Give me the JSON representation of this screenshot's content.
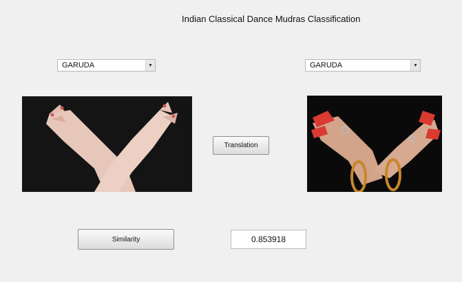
{
  "window": {
    "title": "Indian Classical Dance Mudras Classification"
  },
  "left_panel": {
    "selected": "GARUDA",
    "image_icon": "hands-image"
  },
  "right_panel": {
    "selected": "GARUDA",
    "image_icon": "hands-image"
  },
  "buttons": {
    "translation": "Translation",
    "similarity": "Similarity"
  },
  "result": {
    "similarity_value": "0.853918"
  }
}
